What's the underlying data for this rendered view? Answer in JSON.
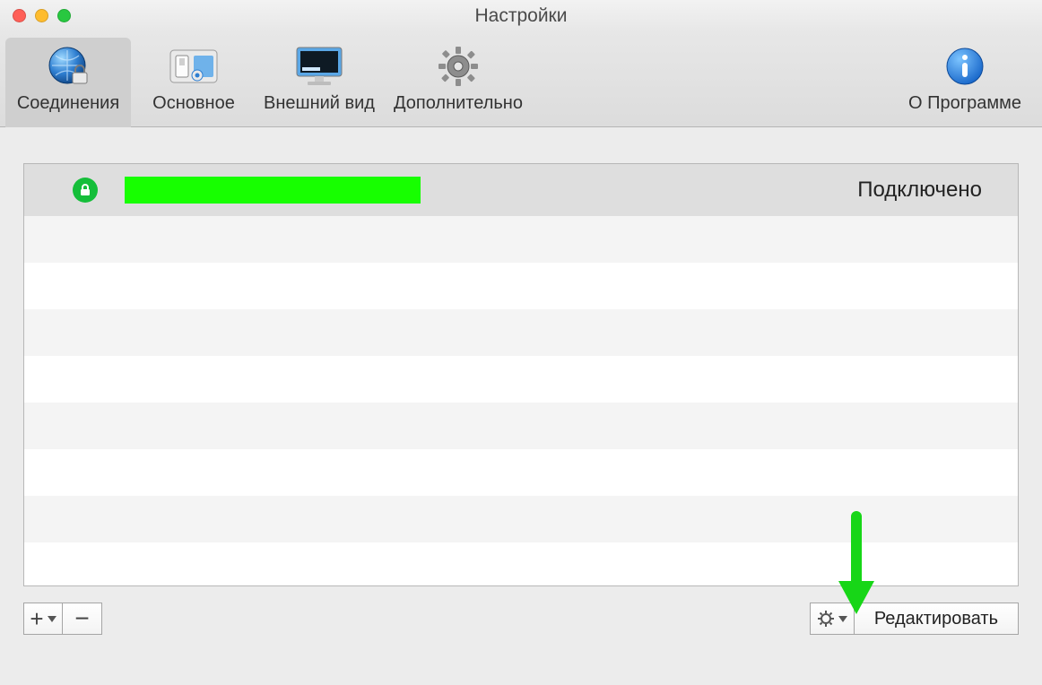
{
  "window": {
    "title": "Настройки"
  },
  "toolbar": {
    "items": [
      {
        "id": "connections",
        "label": "Соединения",
        "icon": "globe-network-icon",
        "selected": true
      },
      {
        "id": "general",
        "label": "Основное",
        "icon": "switch-icon",
        "selected": false
      },
      {
        "id": "appearance",
        "label": "Внешний вид",
        "icon": "display-icon",
        "selected": false
      },
      {
        "id": "advanced",
        "label": "Дополнительно",
        "icon": "gear-icon",
        "selected": false
      }
    ],
    "about": {
      "label": "О Программе",
      "icon": "info-icon"
    }
  },
  "connections_list": {
    "rows": [
      {
        "name_redacted": true,
        "status": "Подключено",
        "secure": true
      }
    ]
  },
  "bottom": {
    "add_label": "+",
    "remove_label": "−",
    "edit_label": "Редактировать"
  }
}
